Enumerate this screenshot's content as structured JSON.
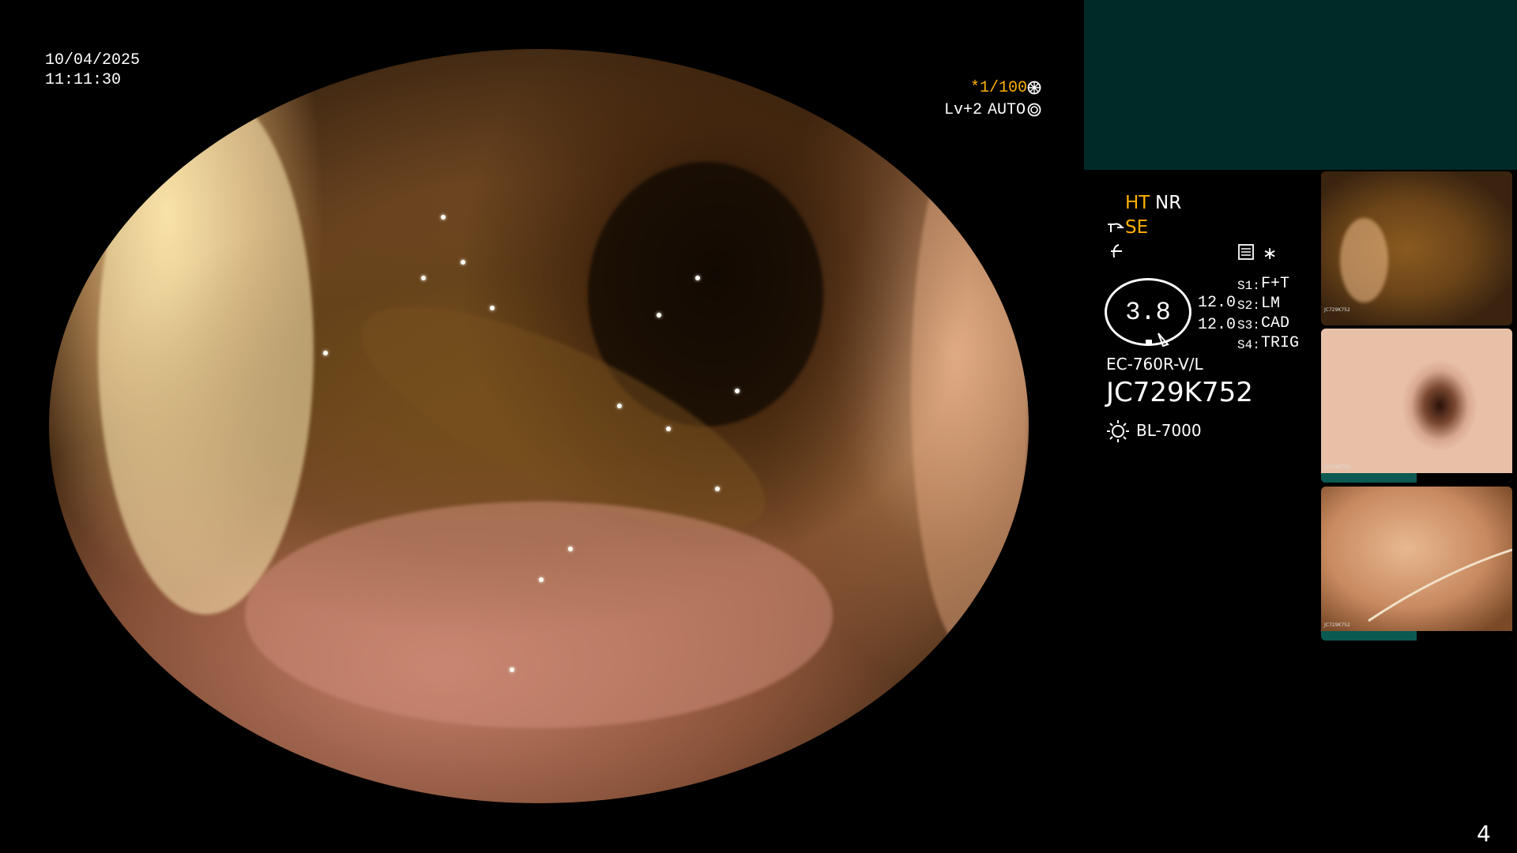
{
  "timestamp": {
    "date": "10/04/2025",
    "time": "11:11:30"
  },
  "exposure": {
    "shutter": "*1/100",
    "level": "Lv+2",
    "mode": "AUTO"
  },
  "enhancement": {
    "ht": "HT",
    "nr": "NR",
    "se": "SE"
  },
  "zoom": {
    "value": "3.8",
    "left_values": [
      "12.0",
      "12.0"
    ]
  },
  "switches": [
    {
      "key": "S1:",
      "value": "F+T"
    },
    {
      "key": "S2:",
      "value": "LM"
    },
    {
      "key": "S3:",
      "value": "CAD"
    },
    {
      "key": "S4:",
      "value": "TRIG"
    }
  ],
  "scope_model": "EC-760R-V/L",
  "serial": "JC729K752",
  "light_source": "BL-7000",
  "page_number": "4",
  "colors": {
    "accent_orange": "#ffb000",
    "panel_teal": "#002a28"
  },
  "thumbnails": [
    {
      "serial": "JC729K752"
    },
    {
      "serial": "JC729K752"
    },
    {
      "serial": "JC729K752"
    }
  ]
}
